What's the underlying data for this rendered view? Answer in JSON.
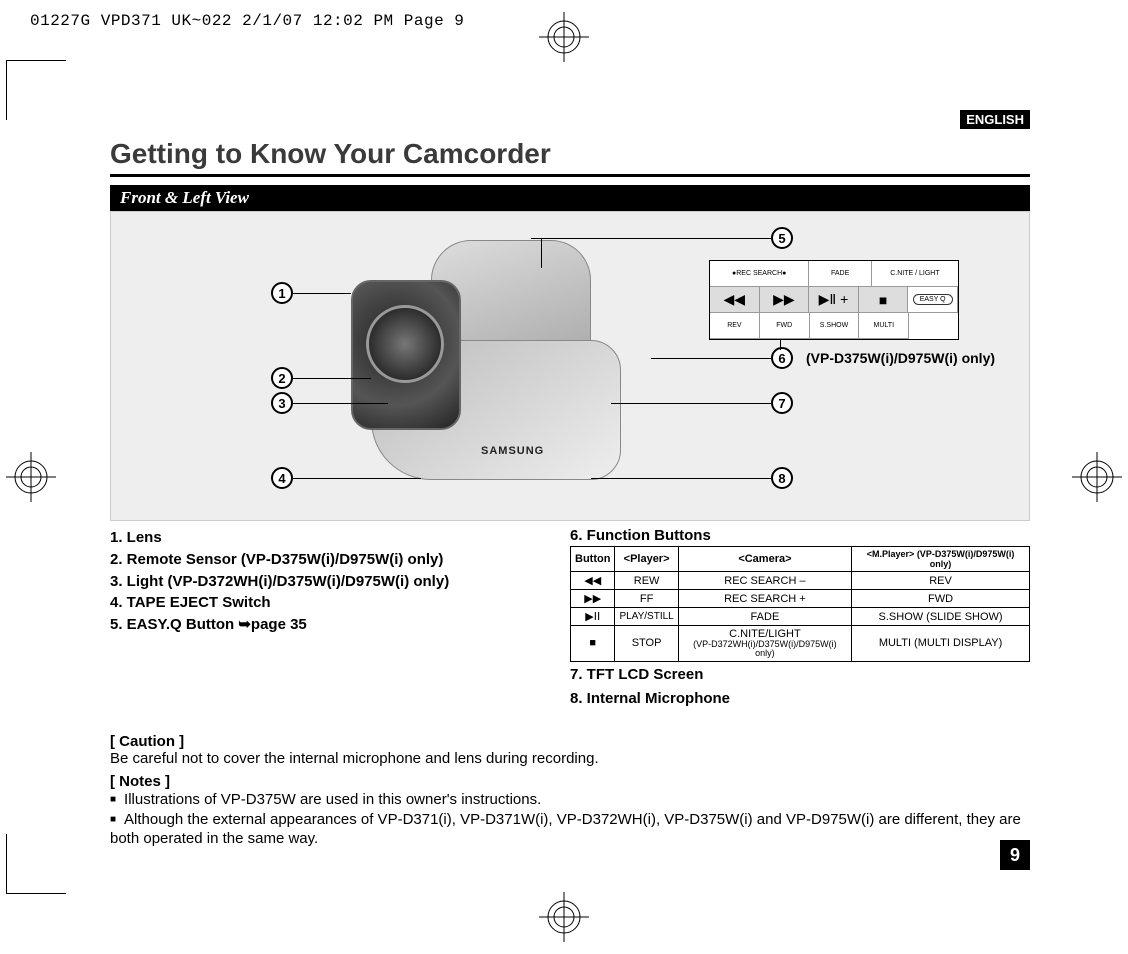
{
  "print_meta": "01227G VPD371 UK~022  2/1/07 12:02 PM  Page 9",
  "language_badge": "ENGLISH",
  "title": "Getting to Know Your Camcorder",
  "section_heading": "Front & Left View",
  "illustration_note": "(VP-D375W(i)/D975W(i) only)",
  "camcorder_brand": "SAMSUNG",
  "callouts": {
    "c1": "1",
    "c2": "2",
    "c3": "3",
    "c4": "4",
    "c5": "5",
    "c6": "6",
    "c7": "7",
    "c8": "8"
  },
  "func_panel": {
    "row1": [
      "REC SEARCH",
      "FADE",
      "C.NITE / LIGHT"
    ],
    "easy": "EASY Q",
    "row3": [
      "REV",
      "FWD",
      "S.SHOW",
      "MULTI"
    ]
  },
  "left_list": [
    "1.  Lens",
    "2.  Remote Sensor (VP-D375W(i)/D975W(i) only)",
    "3.  Light (VP-D372WH(i)/D375W(i)/D975W(i) only)",
    "4.  TAPE EJECT Switch",
    "5.  EASY.Q Button ➥page 35"
  ],
  "function_buttons_title": "6.  Function Buttons",
  "table": {
    "headers": [
      "Button",
      "<Player>",
      "<Camera>",
      "<M.Player> (VP-D375W(i)/D975W(i) only)"
    ],
    "rows": [
      {
        "icon": "rew",
        "player": "REW",
        "camera": "REC SEARCH –",
        "mplayer": "REV"
      },
      {
        "icon": "ff",
        "player": "FF",
        "camera": "REC SEARCH +",
        "mplayer": "FWD"
      },
      {
        "icon": "play",
        "player": "PLAY/STILL",
        "camera": "FADE",
        "mplayer": "S.SHOW (SLIDE SHOW)"
      },
      {
        "icon": "stop",
        "player": "STOP",
        "camera": "C.NITE/LIGHT",
        "camera_sub": "(VP-D372WH(i)/D375W(i)/D975W(i) only)",
        "mplayer": "MULTI (MULTI DISPLAY)"
      }
    ]
  },
  "after_list": [
    "7.  TFT LCD Screen",
    "8.  Internal Microphone"
  ],
  "caution_head": "[ Caution ]",
  "caution_body": "Be careful not to cover the internal microphone and lens during recording.",
  "notes_head": "[ Notes ]",
  "notes": [
    "Illustrations of VP-D375W are used in this owner's instructions.",
    "Although the external appearances of VP-D371(i), VP-D371W(i), VP-D372WH(i), VP-D375W(i) and VP-D975W(i) are different, they are both operated in the same way."
  ],
  "page_number": "9"
}
